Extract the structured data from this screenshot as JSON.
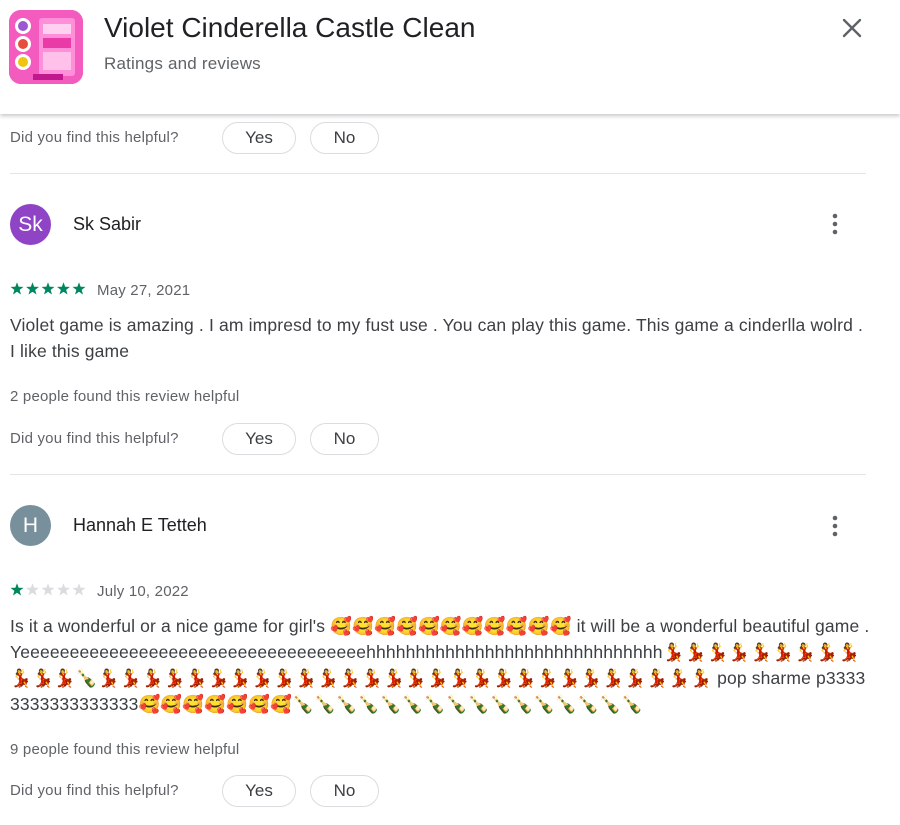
{
  "header": {
    "app_title": "Violet Cinderella Castle Clean",
    "subtitle": "Ratings and reviews",
    "close_icon": "close-icon"
  },
  "helpful": {
    "question": "Did you find this helpful?",
    "yes_label": "Yes",
    "no_label": "No"
  },
  "reviews": [
    {
      "initials": "Sk",
      "avatar_color": "#8e44c4",
      "name": "Sk Sabir",
      "rating": 5,
      "max_rating": 5,
      "date": "May 27, 2021",
      "text": "Violet game is amazing . I am impresd to my fust use . You can play this game. This game a cinderlla wolrd . I like this game",
      "found_helpful": "2 people found this review helpful"
    },
    {
      "initials": "H",
      "avatar_color": "#78909c",
      "name": "Hannah E Tetteh",
      "rating": 1,
      "max_rating": 5,
      "date": "July 10, 2022",
      "text": "Is it a wonderful or a nice game for girl's 🥰🥰🥰🥰🥰🥰🥰🥰🥰🥰🥰 it will be a wonderful beautiful game .Yeeeeeeeeeeeeeeeeeeeeeeeeeeeeeeeeeeehhhhhhhhhhhhhhhhhhhhhhhhhhhhhh💃💃💃💃💃💃💃💃💃💃💃💃🍾💃💃💃💃💃💃💃💃💃💃💃💃💃💃💃💃💃💃💃💃💃💃💃💃💃💃💃💃 pop sharme p33333333333333333🥰🥰🥰🥰🥰🥰🥰🍾🍾🍾🍾🍾🍾🍾🍾🍾🍾🍾🍾🍾🍾🍾🍾",
      "found_helpful": "9 people found this review helpful"
    }
  ],
  "colors": {
    "star_filled": "#01875f",
    "star_empty": "#dadce0",
    "accent": "#01875f"
  },
  "icons": {
    "more": "more-vert-icon",
    "close": "close-icon",
    "star": "star-icon"
  }
}
